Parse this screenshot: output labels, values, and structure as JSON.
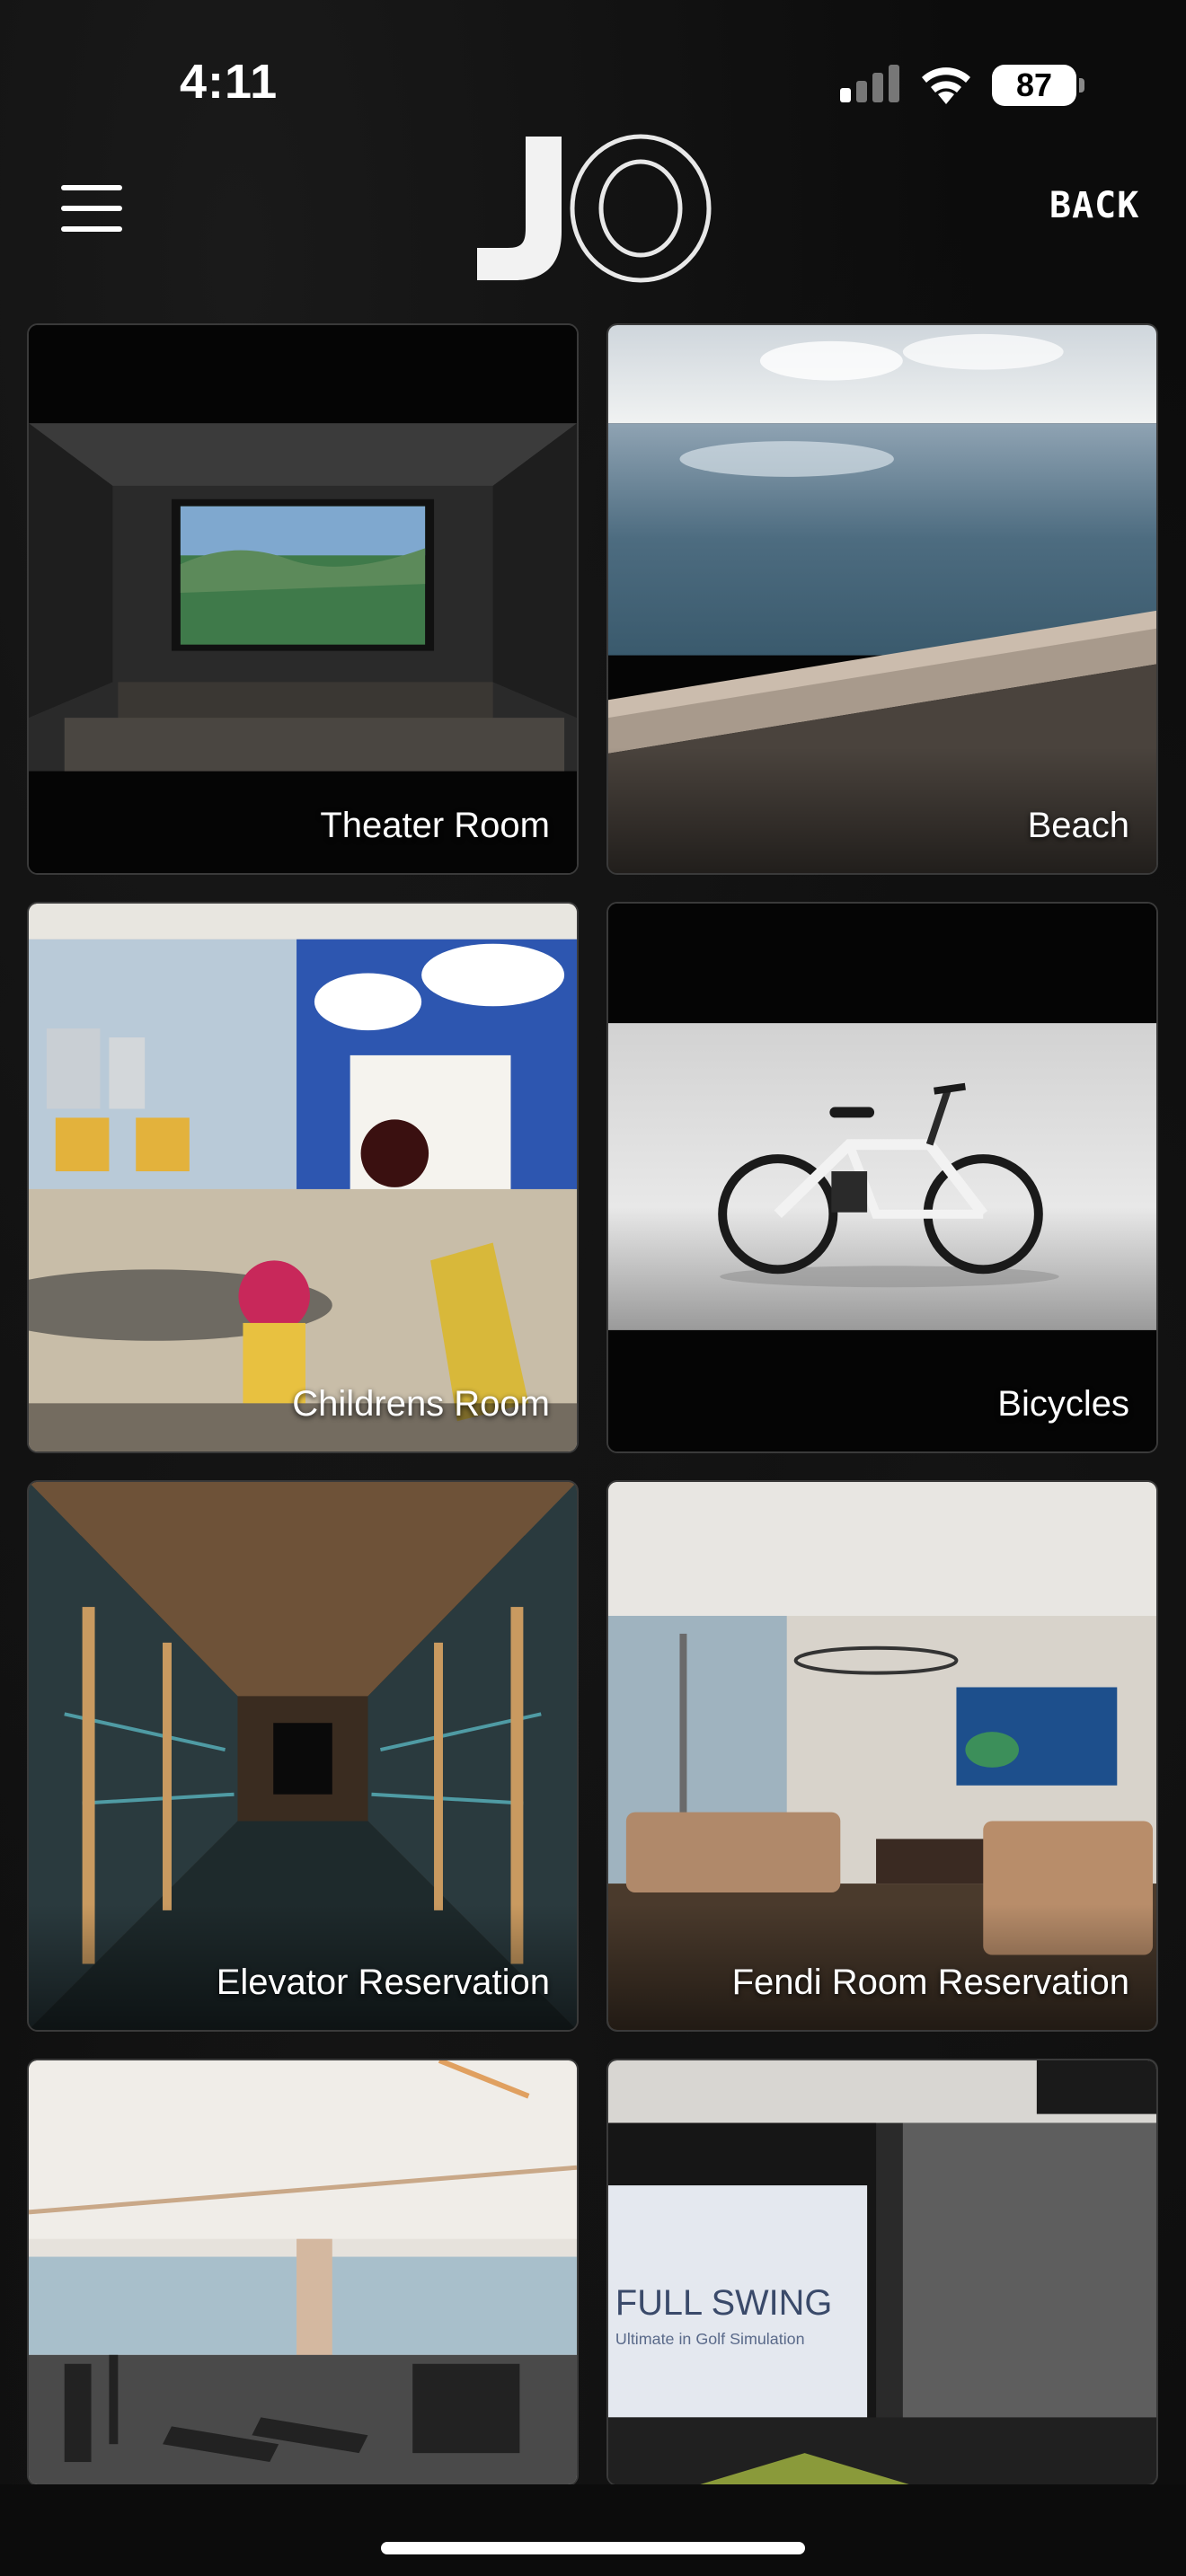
{
  "status_bar": {
    "time": "4:11",
    "battery": "87"
  },
  "header": {
    "logo_text": "JO",
    "back_label": "BACK"
  },
  "tiles": [
    {
      "label": "Theater Room"
    },
    {
      "label": "Beach"
    },
    {
      "label": "Childrens Room"
    },
    {
      "label": "Bicycles"
    },
    {
      "label": "Elevator Reservation"
    },
    {
      "label": "Fendi Room Reservation"
    },
    {
      "label": ""
    },
    {
      "label": ""
    }
  ],
  "images": {
    "golf_screen_text": "FULL SWING",
    "golf_screen_subtext": "Ultimate in Golf Simulation"
  },
  "colors": {
    "background": "#0c0c0c",
    "tile_border": "#3a3a3a",
    "text": "#ffffff"
  }
}
